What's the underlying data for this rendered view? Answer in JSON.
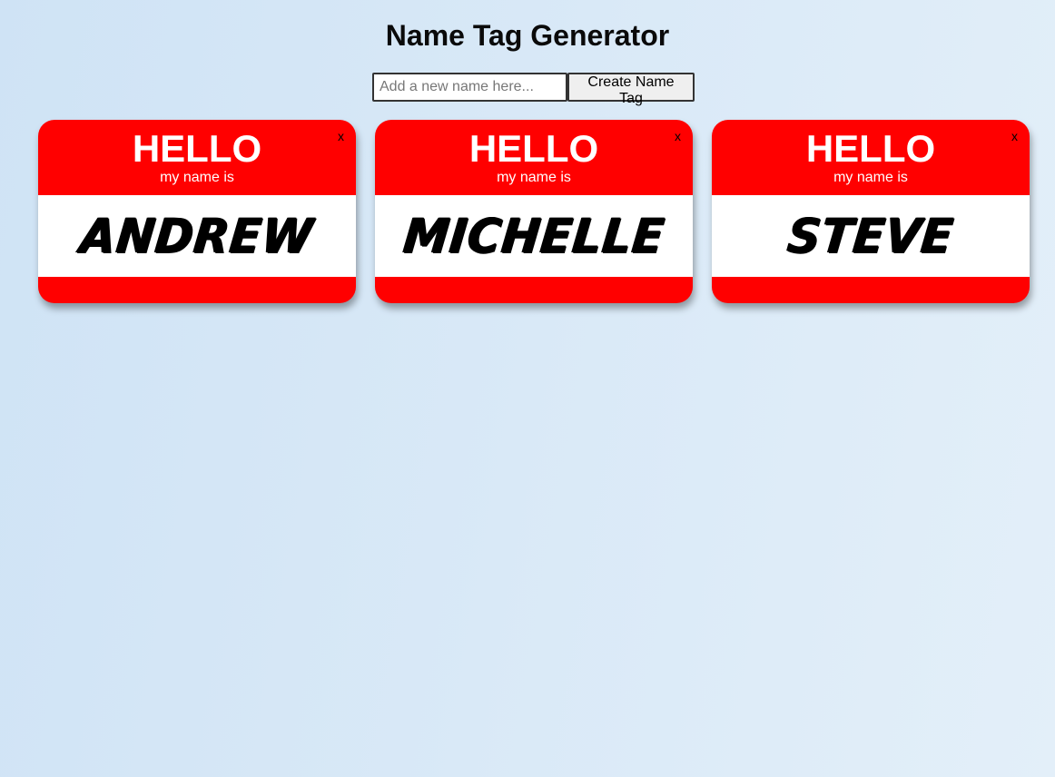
{
  "page": {
    "title": "Name Tag Generator"
  },
  "form": {
    "input_placeholder": "Add a new name here...",
    "input_value": "",
    "button_label": "Create Name Tag"
  },
  "tags": [
    {
      "hello": "HELLO",
      "subtitle": "my name is",
      "name": "ANDREW",
      "close": "x"
    },
    {
      "hello": "HELLO",
      "subtitle": "my name is",
      "name": "MICHELLE",
      "close": "x"
    },
    {
      "hello": "HELLO",
      "subtitle": "my name is",
      "name": "STEVE",
      "close": "x"
    }
  ],
  "colors": {
    "tag_red": "#ff0000",
    "tag_white": "#ffffff",
    "background_start": "#cfe3f5",
    "background_end": "#e3eff9"
  }
}
